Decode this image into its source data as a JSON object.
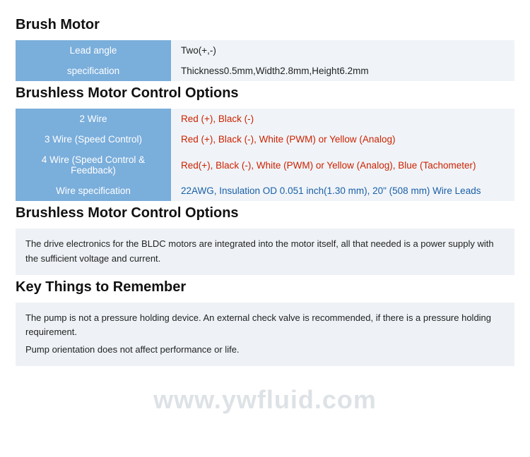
{
  "sections": [
    {
      "id": "brush-motor",
      "title": "Brush Motor",
      "type": "table",
      "rows": [
        {
          "label": "Lead angle",
          "value_plain": "Two(+,-)",
          "value_html": "Two(+,-)"
        },
        {
          "label": "specification",
          "value_plain": "Thickness0.5mm,Width2.8mm,Height6.2mm",
          "value_html": "Thickness0.5mm,Width2.8mm,Height6.2mm"
        }
      ]
    },
    {
      "id": "brushless-control-options",
      "title": "Brushless Motor Control Options",
      "type": "table",
      "rows": [
        {
          "label": "2 Wire",
          "value_html": "<span class='red'>Red (+), Black (-)</span>"
        },
        {
          "label": "3 Wire (Speed Control)",
          "value_html": "<span class='red'>Red (+), Black (-), White (PWM) or Yellow (Analog)</span>"
        },
        {
          "label": "4 Wire (Speed Control & Feedback)",
          "value_html": "<span class='red'>Red(+), Black (-), White (PWM) or Yellow (Analog), Blue (Tachometer)</span>"
        },
        {
          "label": "Wire specification",
          "value_html": "<span class='blue'>22AWG, Insulation OD 0.051 inch(1.30 mm), 20\" (508 mm) Wire Leads</span>"
        }
      ]
    },
    {
      "id": "brushless-control-description",
      "title": "Brushless Motor Control Options",
      "type": "description",
      "text": "The drive electronics for the BLDC motors are integrated into the motor itself, all that needed is a power supply with the sufficient voltage and current."
    },
    {
      "id": "key-things",
      "title": "Key Things to Remember",
      "type": "description",
      "lines": [
        "The pump is not a pressure holding device. An external check valve is recommended, if there is a pressure holding requirement.",
        "Pump orientation does not affect performance or life."
      ]
    }
  ],
  "watermark": "www.ywfluid.com"
}
